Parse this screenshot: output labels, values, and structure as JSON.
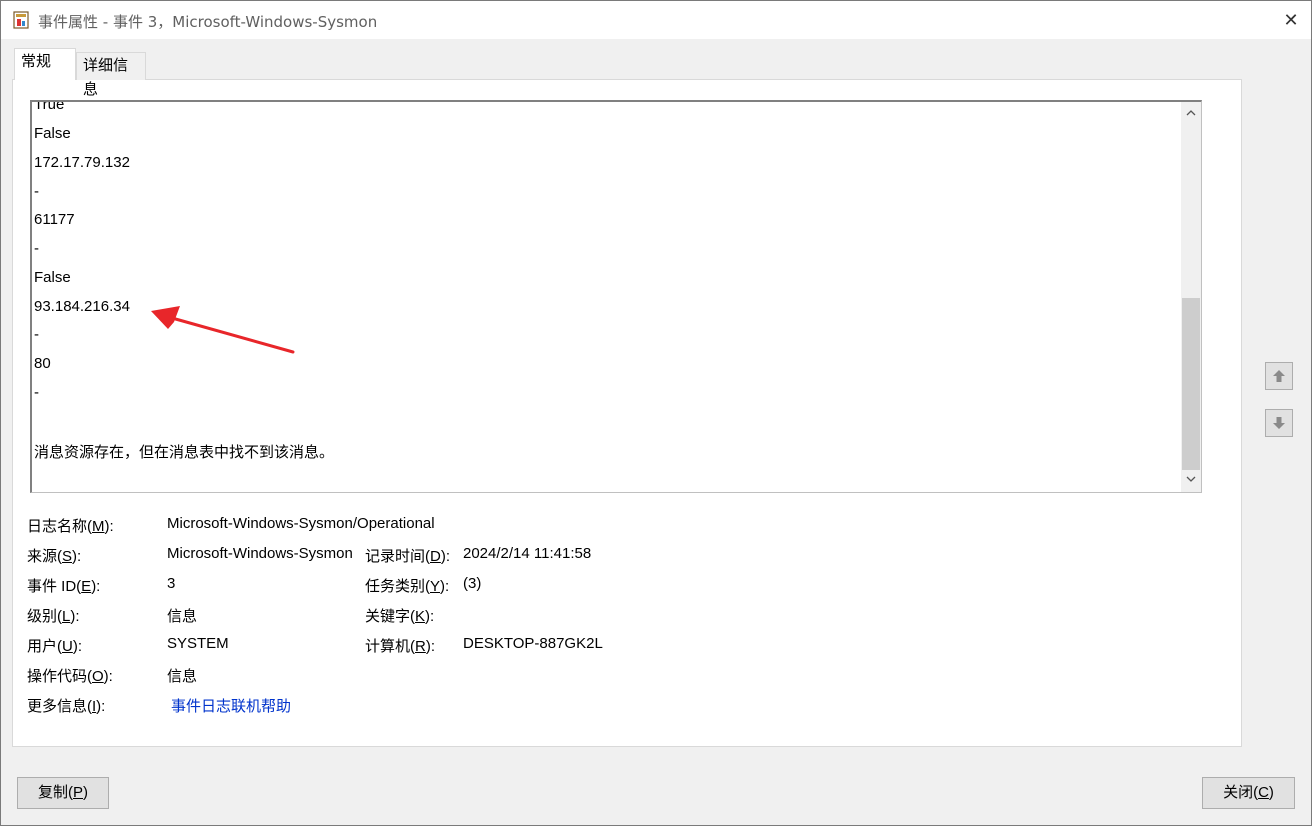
{
  "window": {
    "title": "事件属性 - 事件 3，Microsoft-Windows-Sysmon",
    "close_symbol": "✕",
    "app_icon": "event-viewer-icon"
  },
  "tabs": [
    {
      "label": "常规",
      "selected": true
    },
    {
      "label": "详细信息",
      "selected": false
    }
  ],
  "description": {
    "partial_top_line": "True",
    "lines": [
      "False",
      "172.17.79.132",
      "-",
      "61177",
      "-",
      "False",
      "93.184.216.34",
      "-",
      "80",
      "-",
      "",
      "消息资源存在，但在消息表中找不到该消息。"
    ]
  },
  "fields": {
    "log_name": {
      "label": "日志名称(",
      "key": "M",
      "suffix": "):",
      "value": "Microsoft-Windows-Sysmon/Operational"
    },
    "source": {
      "label": "来源(",
      "key": "S",
      "suffix": "):",
      "value": "Microsoft-Windows-Sysmon"
    },
    "event_id": {
      "label": "事件 ID(",
      "key": "E",
      "suffix": "):",
      "value": "3"
    },
    "level": {
      "label": "级别(",
      "key": "L",
      "suffix": "):",
      "value": "信息"
    },
    "user": {
      "label": "用户(",
      "key": "U",
      "suffix": "):",
      "value": "SYSTEM"
    },
    "opcode": {
      "label": "操作代码(",
      "key": "O",
      "suffix": "):",
      "value": "信息"
    },
    "more_info": {
      "label": "更多信息(",
      "key": "I",
      "suffix": "):",
      "value": "事件日志联机帮助"
    },
    "logged": {
      "label": "记录时间(",
      "key": "D",
      "suffix": "):",
      "value": "2024/2/14 11:41:58"
    },
    "task_category": {
      "label": "任务类别(",
      "key": "Y",
      "suffix": "):",
      "value": "(3)"
    },
    "keywords": {
      "label": "关键字(",
      "key": "K",
      "suffix": "):",
      "value": ""
    },
    "computer": {
      "label": "计算机(",
      "key": "R",
      "suffix": "):",
      "value": "DESKTOP-887GK2L"
    }
  },
  "buttons": {
    "copy": {
      "label": "复制(",
      "key": "P",
      "suffix": ")"
    },
    "close": {
      "label": "关闭(",
      "key": "C",
      "suffix": ")"
    }
  },
  "colors": {
    "annotation_arrow": "#e8262a",
    "link": "#0033cc",
    "window_bg": "#f0f0f0"
  }
}
